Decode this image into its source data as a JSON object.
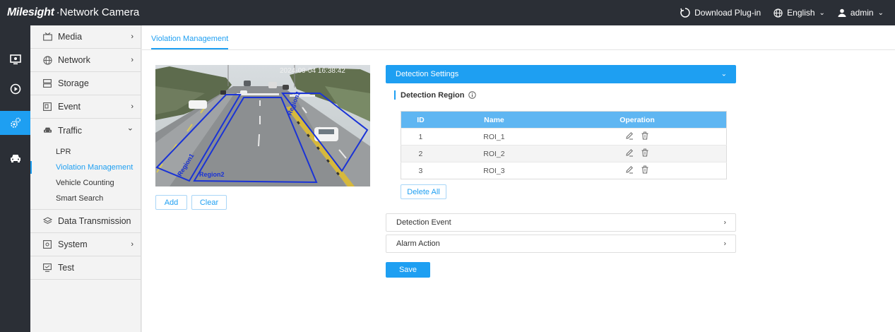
{
  "header": {
    "brand": "Milesight",
    "product": "·Network Camera",
    "download_label": "Download Plug-in",
    "language": "English",
    "user": "admin"
  },
  "rail": {
    "items": [
      {
        "icon": "live-view-icon",
        "active": false
      },
      {
        "icon": "playback-icon",
        "active": false
      },
      {
        "icon": "settings-icon",
        "active": true
      },
      {
        "icon": "vehicle-icon",
        "active": false
      }
    ]
  },
  "sidebar": {
    "items": [
      {
        "label": "Media",
        "icon": "media-icon",
        "chevron": "›"
      },
      {
        "label": "Network",
        "icon": "globe-icon",
        "chevron": "›"
      },
      {
        "label": "Storage",
        "icon": "storage-icon",
        "chevron": ""
      },
      {
        "label": "Event",
        "icon": "event-icon",
        "chevron": "›"
      },
      {
        "label": "Traffic",
        "icon": "car-icon",
        "chevron": "⌄"
      },
      {
        "label": "Data Transmission",
        "icon": "layers-icon",
        "chevron": ""
      },
      {
        "label": "System",
        "icon": "system-icon",
        "chevron": "›"
      },
      {
        "label": "Test",
        "icon": "test-icon",
        "chevron": ""
      }
    ],
    "traffic_sub": [
      {
        "label": "LPR",
        "active": false
      },
      {
        "label": "Violation Management",
        "active": true
      },
      {
        "label": "Vehicle Counting",
        "active": false
      },
      {
        "label": "Smart Search",
        "active": false
      }
    ]
  },
  "main": {
    "tab": "Violation Management",
    "video": {
      "timestamp": "2024-09-04 16:38:42",
      "regions": [
        "Region1",
        "Region2",
        "Region3"
      ]
    },
    "add_label": "Add",
    "clear_label": "Clear",
    "detection_settings": "Detection Settings",
    "detection_region": "Detection Region",
    "table": {
      "headers": [
        "ID",
        "Name",
        "Operation"
      ],
      "rows": [
        {
          "id": "1",
          "name": "ROI_1"
        },
        {
          "id": "2",
          "name": "ROI_2"
        },
        {
          "id": "3",
          "name": "ROI_3"
        }
      ]
    },
    "delete_all_label": "Delete All",
    "detection_event": "Detection Event",
    "alarm_action": "Alarm Action",
    "save_label": "Save"
  },
  "colors": {
    "accent": "#1e9ff2",
    "topbar": "#2b2f36",
    "table_header": "#5fb6f2",
    "region_outline": "#1a33d6"
  }
}
